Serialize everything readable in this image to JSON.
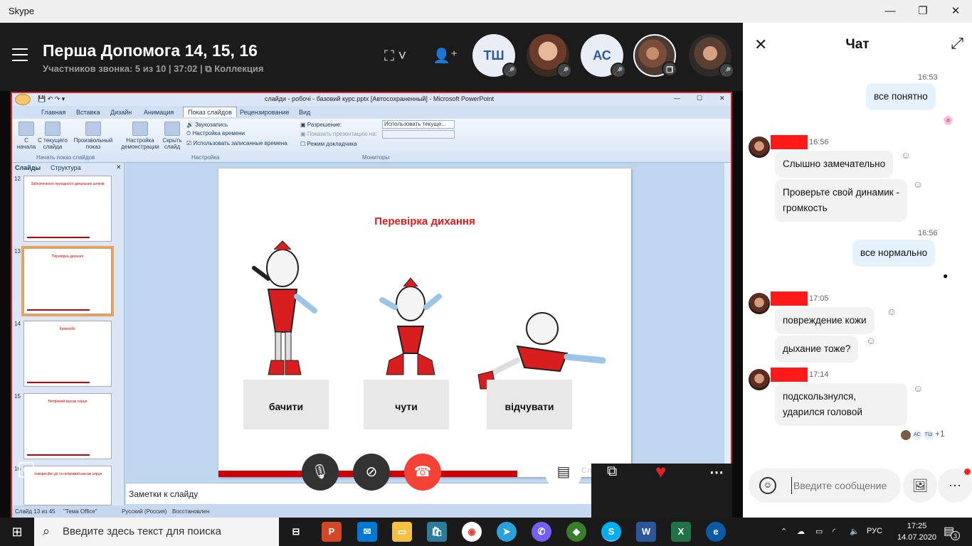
{
  "window": {
    "app_name": "Skype",
    "minimize": "—",
    "maximize": "❐",
    "close": "✕"
  },
  "call": {
    "title": "Перша Допомога 14, 15, 16",
    "subtitle_info": "Участников звонка: 5 из 10 | 37:02 |",
    "collection_label": "Коллекция",
    "participants": [
      {
        "initials": "ТШ"
      },
      {
        "initials": ""
      },
      {
        "initials": "АС"
      },
      {
        "initials": ""
      },
      {
        "initials": ""
      }
    ]
  },
  "ppt": {
    "window_title": "слайди - робочі - базовий курс.pptx [Автосохраненный] - Microsoft PowerPoint",
    "tabs": [
      "Главная",
      "Вставка",
      "Дизайн",
      "Анимация",
      "Показ слайдов",
      "Рецензирование",
      "Вид"
    ],
    "ribbon": {
      "from_start": "С начала",
      "from_current": "С текущего слайда",
      "custom": "Произвольный показ",
      "setup": "Настройка демонстрации",
      "hide": "Скрыть слайд",
      "group_start": "Начать показ слайдов",
      "record_narration": "Звукозапись",
      "rehearse": "Настройка времени",
      "use_timings": "Использовать записанные времена",
      "group_setup": "Настройка",
      "resolution_label": "Разрешение:",
      "resolution_value": "Использовать текуще...",
      "show_on_label": "Показать презентацию на:",
      "presenter_view": "Режим докладчика",
      "group_monitors": "Мониторы"
    },
    "panel_tabs": [
      "Слайды",
      "Структура"
    ],
    "thumbs": [
      {
        "num": "12",
        "caption": "Забезпечення прохідності дихальних шляхів"
      },
      {
        "num": "13",
        "caption": "Перевірка дихання"
      },
      {
        "num": "14",
        "caption": "Кровообіг"
      },
      {
        "num": "15",
        "caption": "Непрямий масаж серця"
      },
      {
        "num": "16",
        "caption": "Компресійні дії та непрямий масаж серця"
      }
    ],
    "slide": {
      "title": "Перевірка дихання",
      "labels": [
        "бачити",
        "чути",
        "відчувати"
      ]
    },
    "notes_placeholder": "Заметки к слайду",
    "status": {
      "slide_of": "Слайд 13 из 45",
      "theme": "\"Тема Office\"",
      "language": "Русский (Россия)",
      "recovered": "Восстановлен"
    },
    "partial_text": "Сл"
  },
  "chat": {
    "title": "Чат",
    "messages": [
      {
        "time": "16:53",
        "text": "все понятно"
      },
      {
        "time": "16:56",
        "text": "Слышно замечательно"
      },
      {
        "text": "Проверьте свой динамик - громкость"
      },
      {
        "time": "16:56",
        "text": "все нормально"
      },
      {
        "time": "17:05",
        "text": "повреждение кожи"
      },
      {
        "text": "дыхание тоже?"
      },
      {
        "time": "17:14",
        "text": "подскользнулся, ударился головой"
      }
    ],
    "read_receipts": [
      "АС",
      "ТШ"
    ],
    "read_more": "+1",
    "input_placeholder": "Введите сообщение"
  },
  "taskbar": {
    "search_placeholder": "Введите здесь текст для поиска",
    "language": "РУС",
    "time": "17:25",
    "date": "14.07.2020",
    "notifications": "3"
  },
  "colors": {
    "accent_red": "#e01b1b",
    "chat_out": "#e4f3fd",
    "hangup": "#f44336"
  }
}
